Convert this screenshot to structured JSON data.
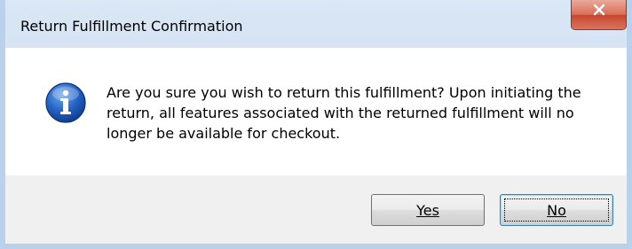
{
  "window": {
    "title": "Return Fulfillment Confirmation",
    "close_icon": "close-icon"
  },
  "message": {
    "icon": "info-icon",
    "text": "Are you sure you wish to return this fulfillment? Upon initiating the return, all features associated with the returned fulfillment will no longer be available for checkout."
  },
  "buttons": {
    "yes_label": "Yes",
    "no_label": "No",
    "default_button": "No"
  },
  "colors": {
    "close_button": "#c8462b",
    "info_icon": "#1f5fbf",
    "frame": "#b9d1ea"
  }
}
